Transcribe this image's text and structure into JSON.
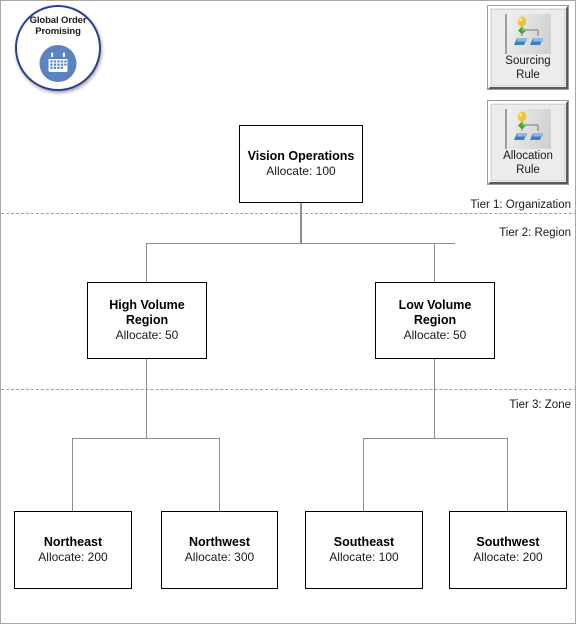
{
  "badge": {
    "name": "Global Order Promising",
    "line1": "Global Order",
    "line2": "Promising",
    "icon": "calendar-icon",
    "ring_color": "#2b3f93",
    "icon_color": "#5b83c0"
  },
  "tools": [
    {
      "id": "sourcing-rule",
      "line1": "Sourcing",
      "line2": "Rule",
      "icon": "rule-hierarchy-icon"
    },
    {
      "id": "allocation-rule",
      "line1": "Allocation",
      "line2": "Rule",
      "icon": "rule-hierarchy-icon"
    }
  ],
  "tiers": [
    {
      "id": "tier-1",
      "label": "Tier 1: Organization"
    },
    {
      "id": "tier-2",
      "label": "Tier 2: Region"
    },
    {
      "id": "tier-3",
      "label": "Tier 3: Zone"
    }
  ],
  "nodes": {
    "organization": {
      "title": "Vision Operations",
      "allocate": "Allocate: 100"
    },
    "high_volume": {
      "title_line1": "High Volume",
      "title_line2": "Region",
      "allocate": "Allocate: 50"
    },
    "low_volume": {
      "title_line1": "Low Volume",
      "title_line2": "Region",
      "allocate": "Allocate: 50"
    },
    "northeast": {
      "title": "Northeast",
      "allocate": "Allocate: 200"
    },
    "northwest": {
      "title": "Northwest",
      "allocate": "Allocate: 300"
    },
    "southeast": {
      "title": "Southeast",
      "allocate": "Allocate: 100"
    },
    "southwest": {
      "title": "Southwest",
      "allocate": "Allocate: 200"
    }
  },
  "colors": {
    "node_border": "#000000",
    "connector": "#8d8d8d",
    "divider": "#9d9d9d",
    "canvas_border": "#a8a8a8"
  }
}
